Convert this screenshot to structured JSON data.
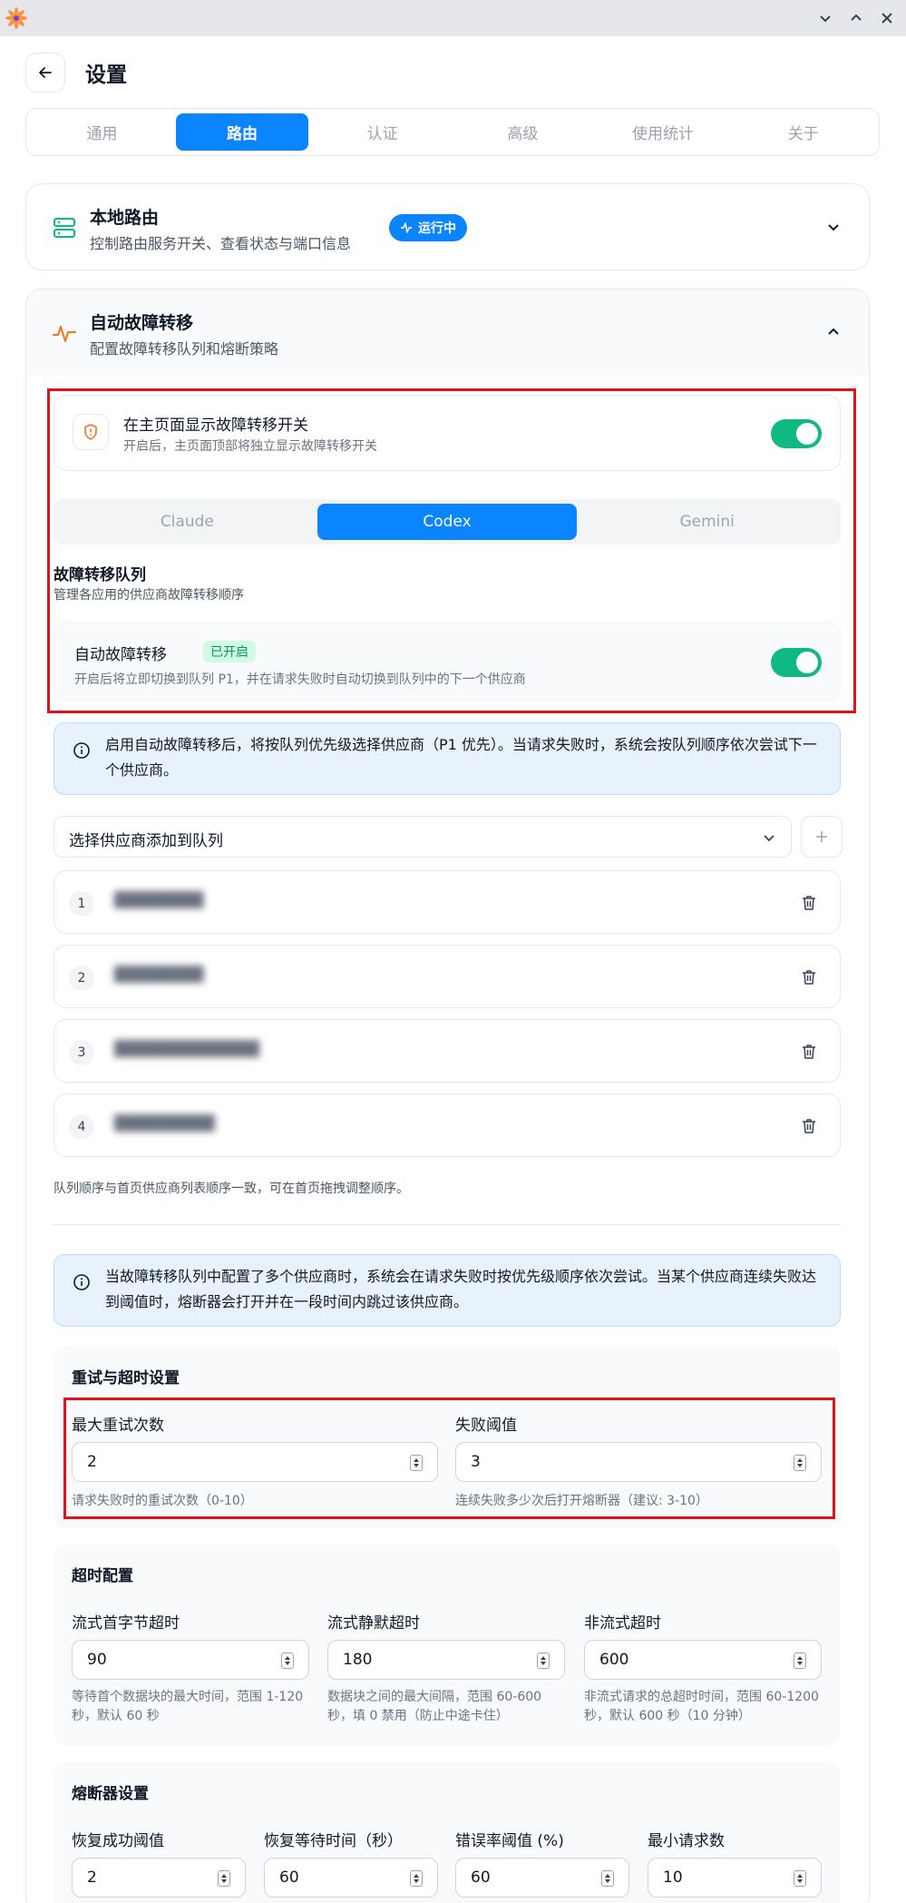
{
  "window": {
    "minimize_icon": "chevron-down-icon",
    "maximize_icon": "chevron-up-icon",
    "close_icon": "close-icon"
  },
  "header": {
    "title": "设置"
  },
  "tabs": [
    {
      "label": "通用"
    },
    {
      "label": "路由",
      "active": true
    },
    {
      "label": "认证"
    },
    {
      "label": "高级"
    },
    {
      "label": "使用统计"
    },
    {
      "label": "关于"
    }
  ],
  "local_routing": {
    "title": "本地路由",
    "subtitle": "控制路由服务开关、查看状态与端口信息",
    "status": "运行中"
  },
  "failover": {
    "title": "自动故障转移",
    "subtitle": "配置故障转移队列和熔断策略",
    "show_toggle": {
      "title": "在主页面显示故障转移开关",
      "subtitle": "开启后，主页面顶部将独立显示故障转移开关",
      "enabled": true
    },
    "apps": [
      "Claude",
      "Codex",
      "Gemini"
    ],
    "selected_app": "Codex",
    "queue_title": "故障转移队列",
    "queue_subtitle": "管理各应用的供应商故障转移顺序",
    "auto": {
      "title": "自动故障转移",
      "badge": "已开启",
      "subtitle": "开启后将立即切换到队列 P1，并在请求失败时自动切换到队列中的下一个供应商",
      "enabled": true
    },
    "info1": "启用自动故障转移后，将按队列优先级选择供应商（P1 优先）。当请求失败时，系统会按队列顺序依次尝试下一个供应商。",
    "select_placeholder": "选择供应商添加到队列",
    "queue": [
      {
        "num": "1",
        "name": "████████"
      },
      {
        "num": "2",
        "name": "████████"
      },
      {
        "num": "3",
        "name": "█████████████"
      },
      {
        "num": "4",
        "name": "█████████"
      }
    ],
    "queue_note": "队列顺序与首页供应商列表顺序一致，可在首页拖拽调整顺序。",
    "info2": "当故障转移队列中配置了多个供应商时，系统会在请求失败时按优先级顺序依次尝试。当某个供应商连续失败达到阈值时，熔断器会打开并在一段时间内跳过该供应商。"
  },
  "retry": {
    "title": "重试与超时设置",
    "max_retries": {
      "label": "最大重试次数",
      "value": "2",
      "help": "请求失败时的重试次数（0-10）"
    },
    "fail_threshold": {
      "label": "失败阈值",
      "value": "3",
      "help": "连续失败多少次后打开熔断器（建议: 3-10）"
    }
  },
  "timeout": {
    "title": "超时配置",
    "first_byte": {
      "label": "流式首字节超时",
      "value": "90",
      "help": "等待首个数据块的最大时间，范围 1-120 秒，默认 60 秒"
    },
    "idle": {
      "label": "流式静默超时",
      "value": "180",
      "help": "数据块之间的最大间隔，范围 60-600 秒，填 0 禁用（防止中途卡住）"
    },
    "non_stream": {
      "label": "非流式超时",
      "value": "600",
      "help": "非流式请求的总超时时间，范围 60-1200 秒，默认 600 秒（10 分钟）"
    }
  },
  "breaker": {
    "title": "熔断器设置",
    "recover_success": {
      "label": "恢复成功阈值",
      "value": "2"
    },
    "recover_wait": {
      "label": "恢复等待时间（秒）",
      "value": "60"
    },
    "error_rate": {
      "label": "错误率阈值 (%)",
      "value": "60"
    },
    "min_requests": {
      "label": "最小请求数",
      "value": "10"
    }
  },
  "colors": {
    "accent": "#0a84ff",
    "toggle_on": "#10b981",
    "highlight_border": "#e0121b",
    "info_bg": "#e8f2fd"
  }
}
